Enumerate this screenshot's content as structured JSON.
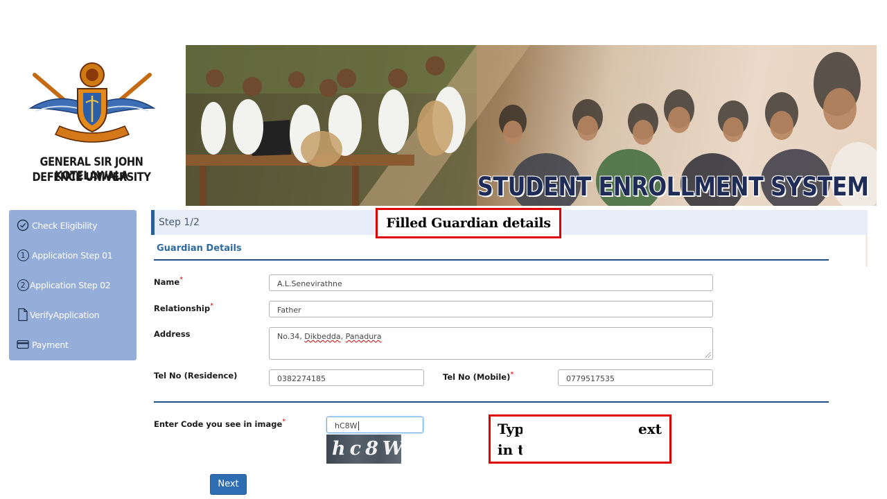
{
  "university": {
    "name_line1": "GENERAL SIR JOHN KOTELAWALA",
    "name_line2": "DEFENCE UNIVERSITY"
  },
  "banner": {
    "title": "STUDENT ENROLLMENT SYSTEM"
  },
  "sidebar": {
    "items": [
      {
        "label": "Check Eligibility",
        "icon": "check-circle-icon"
      },
      {
        "label": "Application Step 01",
        "icon": "number-1-circle-icon",
        "number": "1"
      },
      {
        "label": "Application Step 02",
        "icon": "number-2-circle-icon",
        "number": "2"
      },
      {
        "label": "VerifyApplication",
        "icon": "document-icon"
      },
      {
        "label": "Payment",
        "icon": "credit-card-icon"
      }
    ]
  },
  "step": {
    "label": "Step 1/2"
  },
  "annotations": {
    "top": "Filled Guardian details",
    "bottom_line1_start": "Typ",
    "bottom_line1_end": "ext",
    "bottom_line2_start": "in th"
  },
  "section": {
    "title": "Guardian Details"
  },
  "form": {
    "name": {
      "label": "Name",
      "value": "A.L.Senevirathne"
    },
    "relationship": {
      "label": "Relationship",
      "value": "Father"
    },
    "address": {
      "label": "Address",
      "value_prefix": "No.34, ",
      "value_word1": "Dikbedda",
      "value_sep": ", ",
      "value_word2": "Panadura"
    },
    "tel_residence": {
      "label": "Tel No (Residence)",
      "value": "0382274185"
    },
    "tel_mobile": {
      "label": "Tel No (Mobile)",
      "value": "0779517535"
    },
    "captcha": {
      "label": "Enter Code you see in image",
      "value": "hC8W",
      "image_text": "hc8W"
    },
    "required_mark": "*"
  },
  "buttons": {
    "next": "Next"
  },
  "colors": {
    "sidebar_bg": "#94aed9",
    "accent_blue": "#2e5d9c",
    "section_title": "#2d6aa0",
    "annotation_red": "#e00000",
    "button_blue": "#2f6db3"
  }
}
